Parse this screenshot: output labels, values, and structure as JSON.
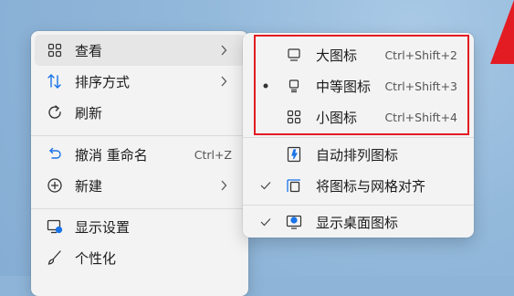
{
  "colors": {
    "desktop_bg": "#8eb5d8",
    "menu_bg": "#f3f3f3",
    "accent_blue": "#1a73e8",
    "highlight_red": "#e31c23"
  },
  "main_menu": {
    "items": [
      {
        "label": "查看",
        "icon": "grid-icon",
        "has_submenu": true
      },
      {
        "label": "排序方式",
        "icon": "sort-icon",
        "has_submenu": true
      },
      {
        "label": "刷新",
        "icon": "refresh-icon",
        "has_submenu": false
      },
      {
        "label": "撤消 重命名",
        "icon": "undo-icon",
        "shortcut": "Ctrl+Z"
      },
      {
        "label": "新建",
        "icon": "add-circle-icon",
        "has_submenu": true
      },
      {
        "label": "显示设置",
        "icon": "display-settings-icon"
      },
      {
        "label": "个性化",
        "icon": "brush-icon"
      }
    ]
  },
  "view_submenu": {
    "items": [
      {
        "label": "大图标",
        "icon": "large-icon-view-icon",
        "shortcut": "Ctrl+Shift+2",
        "selected": false,
        "checked": false
      },
      {
        "label": "中等图标",
        "icon": "medium-icon-view-icon",
        "shortcut": "Ctrl+Shift+3",
        "selected": true,
        "checked": false
      },
      {
        "label": "小图标",
        "icon": "small-icon-view-icon",
        "shortcut": "Ctrl+Shift+4",
        "selected": false,
        "checked": false
      },
      {
        "label": "自动排列图标",
        "icon": "auto-arrange-icon",
        "checked": false
      },
      {
        "label": "将图标与网格对齐",
        "icon": "align-grid-icon",
        "checked": true
      },
      {
        "label": "显示桌面图标",
        "icon": "show-desktop-icons-icon",
        "checked": true
      }
    ]
  }
}
